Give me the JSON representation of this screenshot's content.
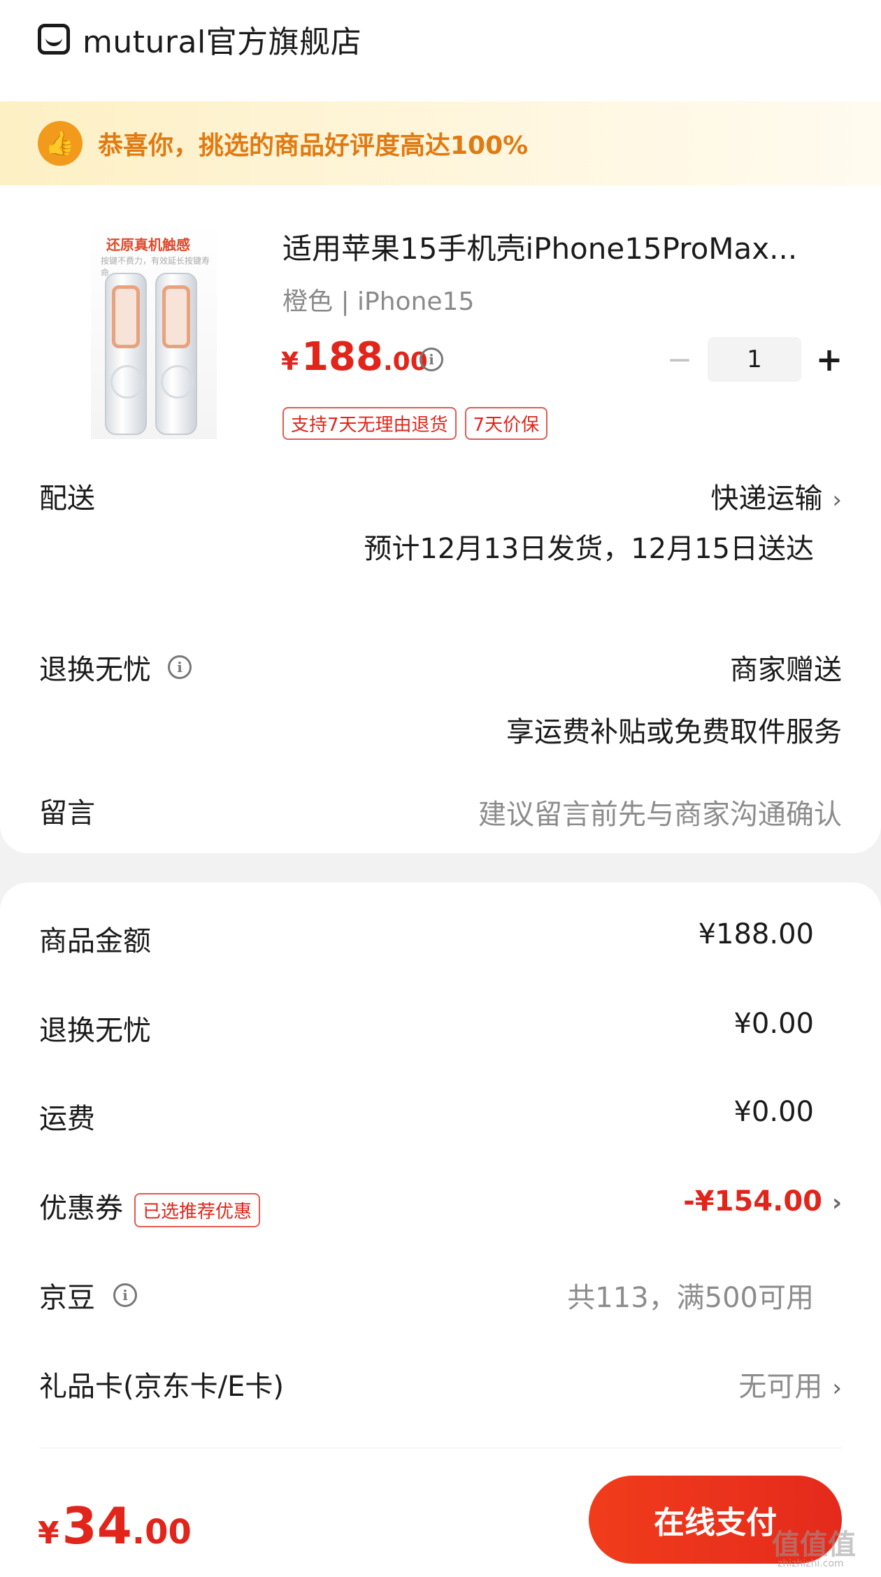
{
  "shop": {
    "icon": "shop-icon",
    "name": "mutural官方旗舰店"
  },
  "banner": {
    "icon": "thumbs-up-icon",
    "text": "恭喜你，挑选的商品好评度高达100%"
  },
  "product": {
    "image_title": "还原真机触感",
    "image_subtitle": "按键不费力，有效延长按键寿命",
    "title": "适用苹果15手机壳iPhone15ProMax...",
    "spec": "橙色 | iPhone15",
    "price": {
      "currency": "¥",
      "integer": "188",
      "decimal": ".00"
    },
    "quantity": "1",
    "minus": "−",
    "plus": "+",
    "tags": [
      "支持7天无理由退货",
      "7天价保"
    ]
  },
  "delivery": {
    "label": "配送",
    "method": "快递运输",
    "estimate": "预计12月13日发货，12月15日送达"
  },
  "return_worry_free": {
    "label": "退换无忧",
    "value": "商家赠送",
    "desc": "享运费补贴或免费取件服务"
  },
  "message": {
    "label": "留言",
    "placeholder": "建议留言前先与商家沟通确认"
  },
  "summary": {
    "goods_amount": {
      "label": "商品金额",
      "value": "¥188.00"
    },
    "return_fee": {
      "label": "退换无忧",
      "value": "¥0.00"
    },
    "shipping": {
      "label": "运费",
      "value": "¥0.00"
    },
    "coupon": {
      "label": "优惠券",
      "badge": "已选推荐优惠",
      "value": "-¥154.00"
    },
    "jingdou": {
      "label": "京豆",
      "value": "共113，满500可用"
    },
    "gift_card": {
      "label": "礼品卡(京东卡/E卡)",
      "value": "无可用"
    }
  },
  "footer": {
    "total": {
      "currency": "¥",
      "integer": "34",
      "decimal": ".00"
    },
    "pay_button": "在线支付"
  },
  "watermark": {
    "text": "值值值",
    "sub": "zhizhizhi.com"
  },
  "colors": {
    "accent": "#e1251b",
    "banner_text": "#e07a12",
    "badge_orange": "#f29a1c"
  }
}
